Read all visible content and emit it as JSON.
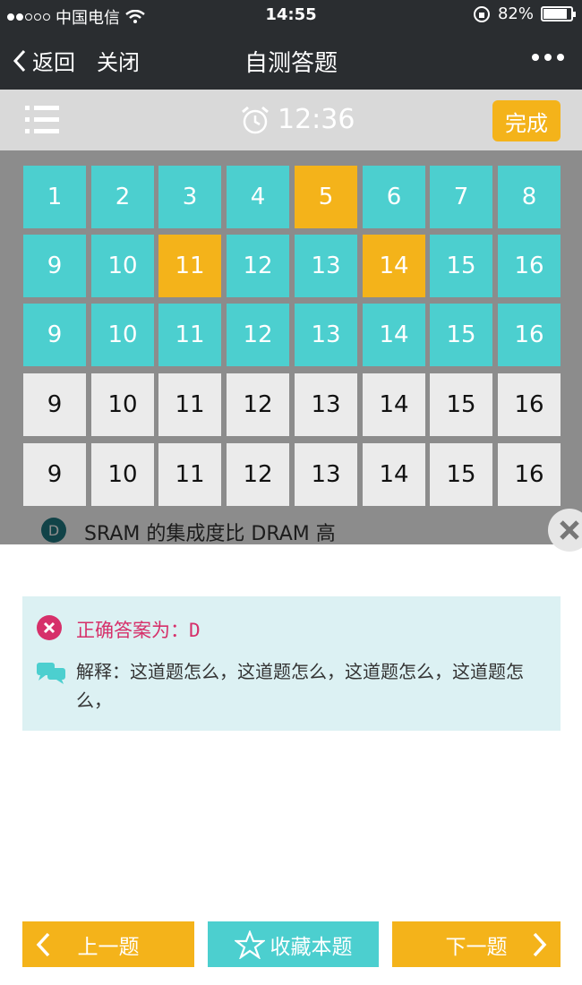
{
  "status_bar": {
    "carrier": "中国电信",
    "time": "14:55",
    "battery": "82%"
  },
  "nav": {
    "back_label": "返回",
    "close_label": "关闭",
    "title": "自测答题"
  },
  "toolbar": {
    "timer": "12:36",
    "done_label": "完成"
  },
  "question_bg": {
    "option_letter": "D",
    "option_text": "SRAM 的集成度比 DRAM 高"
  },
  "grid": {
    "rows": [
      [
        {
          "n": "1",
          "s": "teal"
        },
        {
          "n": "2",
          "s": "teal"
        },
        {
          "n": "3",
          "s": "teal"
        },
        {
          "n": "4",
          "s": "teal"
        },
        {
          "n": "5",
          "s": "orange"
        },
        {
          "n": "6",
          "s": "teal"
        },
        {
          "n": "7",
          "s": "teal"
        },
        {
          "n": "8",
          "s": "teal"
        }
      ],
      [
        {
          "n": "9",
          "s": "teal"
        },
        {
          "n": "10",
          "s": "teal"
        },
        {
          "n": "11",
          "s": "orange"
        },
        {
          "n": "12",
          "s": "teal"
        },
        {
          "n": "13",
          "s": "teal"
        },
        {
          "n": "14",
          "s": "orange"
        },
        {
          "n": "15",
          "s": "teal"
        },
        {
          "n": "16",
          "s": "teal"
        }
      ],
      [
        {
          "n": "9",
          "s": "teal"
        },
        {
          "n": "10",
          "s": "teal"
        },
        {
          "n": "11",
          "s": "teal"
        },
        {
          "n": "12",
          "s": "teal"
        },
        {
          "n": "13",
          "s": "teal"
        },
        {
          "n": "14",
          "s": "teal"
        },
        {
          "n": "15",
          "s": "teal"
        },
        {
          "n": "16",
          "s": "teal"
        }
      ],
      [
        {
          "n": "9",
          "s": "gray"
        },
        {
          "n": "10",
          "s": "gray"
        },
        {
          "n": "11",
          "s": "gray"
        },
        {
          "n": "12",
          "s": "gray"
        },
        {
          "n": "13",
          "s": "gray"
        },
        {
          "n": "14",
          "s": "gray"
        },
        {
          "n": "15",
          "s": "gray"
        },
        {
          "n": "16",
          "s": "gray"
        }
      ],
      [
        {
          "n": "9",
          "s": "gray"
        },
        {
          "n": "10",
          "s": "gray"
        },
        {
          "n": "11",
          "s": "gray"
        },
        {
          "n": "12",
          "s": "gray"
        },
        {
          "n": "13",
          "s": "gray"
        },
        {
          "n": "14",
          "s": "gray"
        },
        {
          "n": "15",
          "s": "gray"
        },
        {
          "n": "16",
          "s": "gray"
        }
      ]
    ]
  },
  "answer": {
    "correct_label": "正确答案为：D",
    "explanation": "解释：这道题怎么，这道题怎么，这道题怎么，这道题怎么，"
  },
  "buttons": {
    "prev_label": "上一题",
    "fav_label": "收藏本题",
    "next_label": "下一题"
  },
  "colors": {
    "teal": "#4ccfcf",
    "orange": "#f4b31a",
    "dark": "#2a2d30",
    "pink": "#d6306a"
  }
}
